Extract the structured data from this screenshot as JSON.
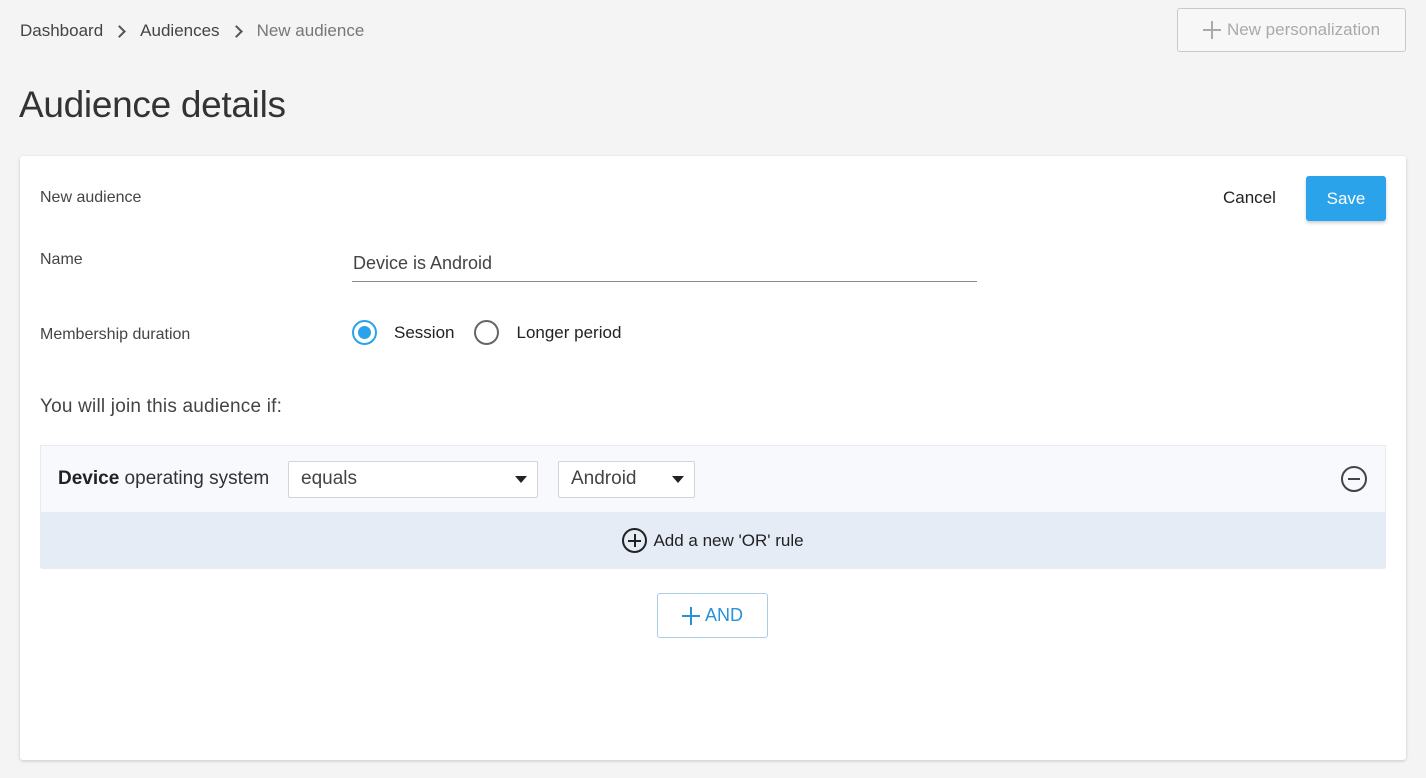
{
  "breadcrumb": {
    "items": [
      "Dashboard",
      "Audiences",
      "New audience"
    ]
  },
  "header": {
    "new_personalization_label": "New personalization",
    "title": "Audience details"
  },
  "card": {
    "header_label": "New audience",
    "cancel_label": "Cancel",
    "save_label": "Save",
    "name_label": "Name",
    "name_value": "Device is Android",
    "membership_label": "Membership duration",
    "membership_options": [
      "Session",
      "Longer period"
    ],
    "membership_selected": "Session",
    "join_text": "You will join this audience if:"
  },
  "rule": {
    "subject_bold": "Device",
    "subject_rest": " operating system",
    "operator": "equals",
    "value": "Android",
    "add_or_label": "Add a new 'OR' rule"
  },
  "and_button_label": "AND",
  "colors": {
    "accent": "#2aa3ea",
    "page_bg": "#f4f4f4",
    "rule_bg": "#f7f9fd",
    "or_row_bg": "#e5ecf6"
  }
}
